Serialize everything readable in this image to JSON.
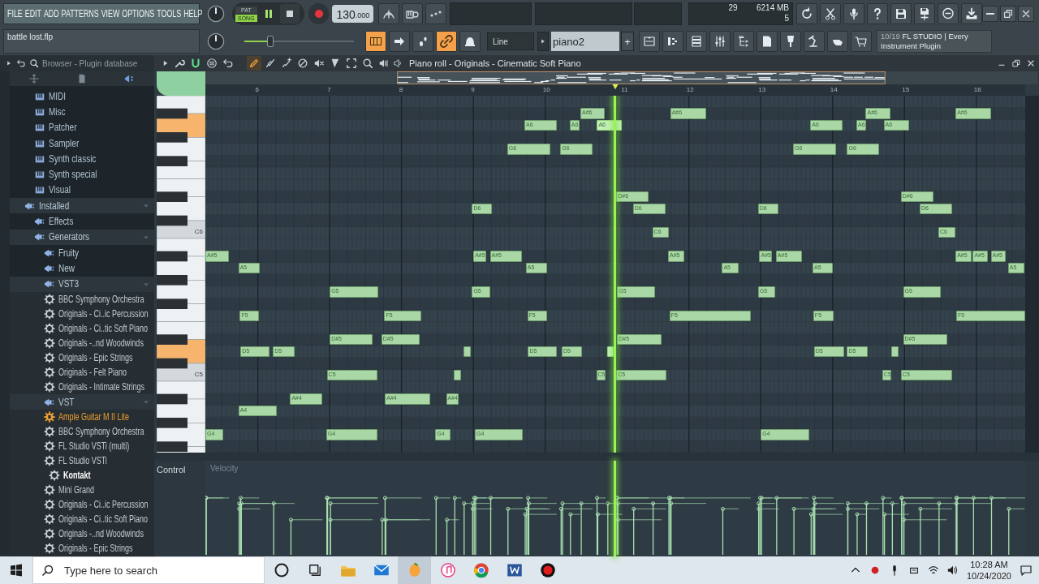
{
  "menu": [
    "FILE",
    "EDIT",
    "ADD",
    "PATTERNS",
    "VIEW",
    "OPTIONS",
    "TOOLS",
    "HELP"
  ],
  "project": {
    "file_name": "battle lost.flp"
  },
  "transport": {
    "modes": [
      {
        "label": "PAT",
        "selected": false
      },
      {
        "label": "SONG",
        "selected": true
      }
    ],
    "playing": true,
    "tempo": "130",
    "tempo_fraction": ".000"
  },
  "master_pitch": {
    "level": 0.24
  },
  "performance": {
    "cpu": "29",
    "memory": "6214 MB",
    "polyphony": "5"
  },
  "toggles": [
    {
      "on": true
    },
    {
      "on": false
    },
    {
      "on": false
    },
    {
      "on": true
    },
    {
      "on": false
    }
  ],
  "snap": {
    "value": "Line"
  },
  "pattern": {
    "value": "piano2",
    "add_label": "+"
  },
  "hint": {
    "counter": "10/19",
    "text": "FL STUDIO | Every Instrument Plugin"
  },
  "browser": {
    "title": "Browser - Plugin database",
    "tree": [
      {
        "kind": "group",
        "children": [
          {
            "kind": "category",
            "label": "MIDI"
          },
          {
            "kind": "category",
            "label": "Misc"
          },
          {
            "kind": "category",
            "label": "Patcher"
          },
          {
            "kind": "category",
            "label": "Sampler"
          },
          {
            "kind": "category",
            "label": "Synth classic"
          },
          {
            "kind": "category",
            "label": "Synth special"
          },
          {
            "kind": "category",
            "label": "Visual"
          }
        ]
      },
      {
        "kind": "folder",
        "label": "Installed",
        "expanded": true,
        "children": [
          {
            "kind": "folder",
            "label": "Effects",
            "expanded": false
          },
          {
            "kind": "folder",
            "label": "Generators",
            "expanded": true,
            "children": [
              {
                "kind": "folder",
                "label": "Fruity",
                "expanded": false
              },
              {
                "kind": "folder",
                "label": "New",
                "expanded": false
              },
              {
                "kind": "folder",
                "label": "VST3",
                "expanded": true,
                "children": [
                  {
                    "kind": "plugin",
                    "label": "BBC Symphony Orchestra",
                    "selected": false
                  },
                  {
                    "kind": "plugin",
                    "label": "Originals - Ci..ic Percussion",
                    "selected": false
                  },
                  {
                    "kind": "plugin",
                    "label": "Originals - Ci..tic Soft Piano",
                    "selected": false
                  },
                  {
                    "kind": "plugin",
                    "label": "Originals -..nd Woodwinds",
                    "selected": false
                  },
                  {
                    "kind": "plugin",
                    "label": "Originals - Epic Strings",
                    "selected": false
                  },
                  {
                    "kind": "plugin",
                    "label": "Originals - Felt Piano",
                    "selected": false
                  },
                  {
                    "kind": "plugin",
                    "label": "Originals - Intimate Strings",
                    "selected": false
                  }
                ]
              },
              {
                "kind": "folder",
                "label": "VST",
                "expanded": true,
                "children": [
                  {
                    "kind": "new_plugin",
                    "label": "Ample Guitar M II Lite",
                    "selected": false
                  },
                  {
                    "kind": "plugin",
                    "label": "BBC Symphony Orchestra",
                    "selected": false
                  },
                  {
                    "kind": "plugin",
                    "label": "FL Studio VSTi (multi)",
                    "selected": false
                  },
                  {
                    "kind": "plugin",
                    "label": "FL Studio VSTi",
                    "selected": false
                  },
                  {
                    "kind": "plugin",
                    "label": "Kontakt",
                    "selected": true
                  },
                  {
                    "kind": "plugin",
                    "label": "Mini Grand",
                    "selected": false
                  },
                  {
                    "kind": "plugin",
                    "label": "Originals - Ci..ic Percussion",
                    "selected": false
                  },
                  {
                    "kind": "plugin",
                    "label": "Originals - Ci..tic Soft Piano",
                    "selected": false
                  },
                  {
                    "kind": "plugin",
                    "label": "Originals -..nd Woodwinds",
                    "selected": false
                  },
                  {
                    "kind": "plugin",
                    "label": "Originals - Epic Strings",
                    "selected": false
                  }
                ]
              }
            ]
          }
        ]
      }
    ]
  },
  "piano_roll": {
    "title": "Piano roll - Originals - Cinematic Soft Piano",
    "snap_on": true,
    "tools": [
      {
        "selected": true
      },
      {
        "selected": false
      },
      {
        "selected": false
      },
      {
        "selected": false
      },
      {
        "selected": false
      },
      {
        "selected": false
      },
      {
        "selected": false
      },
      {
        "selected": false
      },
      {
        "selected": false
      }
    ],
    "ruler": [
      "6",
      "7",
      "8",
      "9",
      "10",
      "11",
      "12",
      "13",
      "14",
      "15",
      "16"
    ],
    "rows": [
      {},
      {
        "notes": [
          {
            "label": "A#6",
            "playing": false
          },
          {
            "label": "A#6",
            "playing": false
          },
          {
            "label": "A#6",
            "playing": false
          },
          {
            "label": "A#6",
            "playing": false
          }
        ]
      },
      {
        "notes": [
          {
            "label": "A6",
            "playing": false
          },
          {
            "label": "A6",
            "playing": false
          },
          {
            "label": "A6",
            "playing": true
          },
          {
            "label": "A6",
            "playing": false
          },
          {
            "label": "A6",
            "playing": false
          },
          {
            "label": "A6",
            "playing": false
          }
        ]
      },
      {},
      {
        "notes": [
          {
            "label": "G6",
            "playing": false
          },
          {
            "label": "G6",
            "playing": false
          },
          {
            "label": "G6",
            "playing": false
          },
          {
            "label": "G6",
            "playing": false
          }
        ]
      },
      {},
      {},
      {},
      {
        "notes": [
          {
            "label": "D#6",
            "playing": false
          },
          {
            "label": "D#6",
            "playing": false
          }
        ]
      },
      {
        "notes": [
          {
            "label": "D6",
            "playing": false
          },
          {
            "label": "D6",
            "playing": false
          },
          {
            "label": "D6",
            "playing": false
          },
          {
            "label": "D6",
            "playing": false
          }
        ]
      },
      {},
      {
        "key_label": "C6",
        "notes": [
          {
            "label": "C6",
            "playing": false
          },
          {
            "label": "C6",
            "playing": false
          }
        ]
      },
      {},
      {
        "notes": [
          {
            "label": "A#5",
            "playing": false
          },
          {
            "label": "A#5",
            "playing": false
          },
          {
            "label": "A#5",
            "playing": false
          },
          {
            "label": "A#5",
            "playing": false
          },
          {
            "label": "A#5",
            "playing": false
          },
          {
            "label": "A#5",
            "playing": false
          },
          {
            "label": "A#5",
            "playing": false
          },
          {
            "label": "A#5",
            "playing": false
          },
          {
            "label": "A#5",
            "playing": false
          }
        ]
      },
      {
        "notes": [
          {
            "label": "A5",
            "playing": false
          },
          {
            "label": "A5",
            "playing": false
          },
          {
            "label": "A5",
            "playing": false
          },
          {
            "label": "A5",
            "playing": false
          },
          {
            "label": "A5",
            "playing": false
          }
        ]
      },
      {},
      {
        "notes": [
          {
            "label": "G5",
            "playing": false
          },
          {
            "label": "G5",
            "playing": false
          },
          {
            "label": "G5",
            "playing": false
          },
          {
            "label": "G5",
            "playing": false
          },
          {
            "label": "G5",
            "playing": false
          }
        ]
      },
      {},
      {
        "notes": [
          {
            "label": "F5",
            "playing": false
          },
          {
            "label": "F5",
            "playing": false
          },
          {
            "label": "F5",
            "playing": false
          },
          {
            "label": "F5",
            "playing": false
          },
          {
            "label": "F5",
            "playing": false
          },
          {
            "label": "F5",
            "playing": false
          }
        ]
      },
      {},
      {
        "notes": [
          {
            "label": "D#5",
            "playing": false
          },
          {
            "label": "D#5",
            "playing": false
          },
          {
            "label": "D#5",
            "playing": false
          },
          {
            "label": "D#5",
            "playing": false
          }
        ]
      },
      {
        "notes": [
          {
            "label": "D5",
            "playing": false
          },
          {
            "label": "D5",
            "playing": false
          },
          {
            "playing": false
          },
          {
            "label": "D5",
            "playing": false
          },
          {
            "label": "D5",
            "playing": false
          },
          {
            "playing": true
          },
          {
            "label": "D5",
            "playing": false
          },
          {
            "label": "D5",
            "playing": false
          },
          {
            "playing": false
          }
        ]
      },
      {},
      {
        "key_label": "C5",
        "notes": [
          {
            "label": "C5",
            "playing": false
          },
          {
            "playing": false
          },
          {
            "label": "C5",
            "playing": false
          },
          {
            "label": "C5",
            "playing": false
          },
          {
            "label": "C5",
            "playing": false
          },
          {
            "label": "C5",
            "playing": false
          }
        ]
      },
      {},
      {
        "notes": [
          {
            "label": "A#4",
            "playing": false
          },
          {
            "label": "A#4",
            "playing": false
          },
          {
            "label": "A#4",
            "playing": false
          }
        ]
      },
      {
        "notes": [
          {
            "label": "A4",
            "playing": false
          }
        ]
      },
      {},
      {
        "notes": [
          {
            "label": "G4",
            "playing": false
          },
          {
            "label": "G4",
            "playing": false
          },
          {
            "label": "G4",
            "playing": false
          },
          {
            "label": "G4",
            "playing": false
          },
          {
            "label": "G4",
            "playing": false
          }
        ]
      },
      {}
    ],
    "control": {
      "label": "Control",
      "lane": "Velocity"
    }
  },
  "taskbar": {
    "search_placeholder": "Type here to search",
    "apps": [
      {
        "kind": "cortana",
        "active": false
      },
      {
        "kind": "taskview",
        "active": false
      },
      {
        "kind": "explorer",
        "active": false
      },
      {
        "kind": "mail",
        "active": false
      },
      {
        "kind": "flstudio",
        "active": true
      },
      {
        "kind": "itunes",
        "active": false
      },
      {
        "kind": "chrome",
        "active": false
      },
      {
        "kind": "word",
        "active": false
      },
      {
        "kind": "recorder",
        "active": false
      }
    ],
    "time": "10:28 AM",
    "date": "10/24/2020"
  }
}
